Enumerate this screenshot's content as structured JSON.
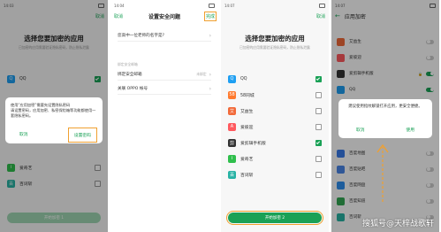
{
  "colors": {
    "accent": "#1aa156",
    "highlight": "#f0a030"
  },
  "phone1": {
    "status_time": "14:03",
    "nav_right": "取消",
    "headline": "选择您要加密的应用",
    "subtitle": "已加密的应用需要验证隐私密码，防止隐私泄露",
    "rows": [
      {
        "label": "QQ",
        "icon": "qq-icon",
        "checked": true
      },
      {
        "label": "爱奇艺",
        "icon": "iqiyi-icon",
        "checked": false
      },
      {
        "label": "百词斩",
        "icon": "baicizhan-icon",
        "checked": false
      }
    ],
    "button_label": "开始加密 1",
    "dialog": {
      "text": "使用“应用加密”需要先设置隐私密码\n请设置密码，应用加密、私密保险箱等功能都使用一套隐私密码。",
      "cancel": "取消",
      "ok": "设置密码"
    }
  },
  "phone2": {
    "status_time": "14:04",
    "nav_left": "取消",
    "nav_title": "设置安全问题",
    "nav_right": "完成",
    "question": "您高中一位老师的名字是?",
    "section_label": "绑定安全邮箱",
    "email_row": "绑定安全邮箱",
    "email_status": "未绑定",
    "oppo_row": "关联 OPPO 帐号"
  },
  "phone3": {
    "status_time": "14:07",
    "nav_right": "取消",
    "headline": "选择您要加密的应用",
    "subtitle": "已加密的应用需要验证隐私密码，防止隐私泄露",
    "rows": [
      {
        "label": "QQ",
        "icon": "qq-icon",
        "checked": true
      },
      {
        "label": "58同城",
        "icon": "58-icon",
        "checked": false
      },
      {
        "label": "艾益生",
        "icon": "aiyisheng-icon",
        "checked": false
      },
      {
        "label": "爱彼迎",
        "icon": "airbnb-icon",
        "checked": false
      },
      {
        "label": "爱剪辑手机版",
        "icon": "aijianji-icon",
        "checked": true
      },
      {
        "label": "爱奇艺",
        "icon": "iqiyi-icon",
        "checked": false
      },
      {
        "label": "百词斩",
        "icon": "baicizhan-icon",
        "checked": false
      }
    ],
    "button_label": "开始加密 2"
  },
  "phone4": {
    "status_time": "14:07",
    "title": "应用加密",
    "rows": [
      {
        "label": "艾益生",
        "on": false
      },
      {
        "label": "爱彼迎",
        "on": false
      },
      {
        "label": "爱剪辑手机版",
        "on": true
      },
      {
        "label": "QQ",
        "on": true
      },
      {
        "label": "百度地图",
        "on": false
      },
      {
        "label": "百度贴吧",
        "on": false
      },
      {
        "label": "百度网盘",
        "on": false
      },
      {
        "label": "百度知道",
        "on": false
      },
      {
        "label": "百词斩",
        "on": false
      }
    ],
    "dialog": {
      "text": "建议使用指纹解锁打开应用，更安全便捷。",
      "cancel": "取消",
      "use": "使用"
    }
  },
  "watermark": "搜狐号@天梓战歌轩"
}
